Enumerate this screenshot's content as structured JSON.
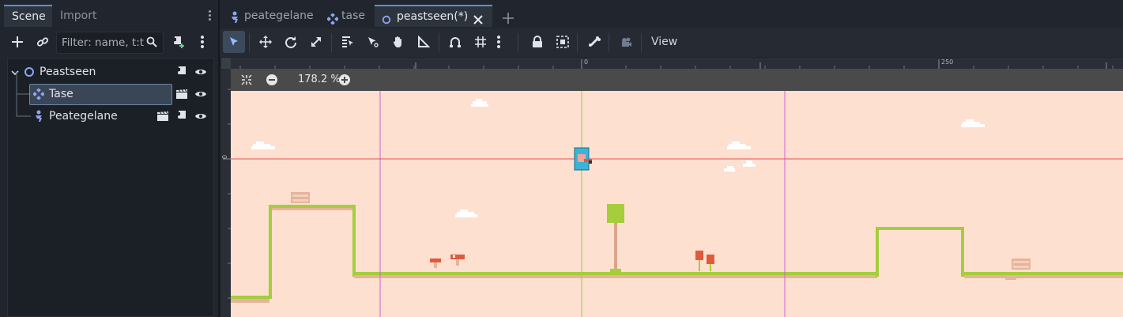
{
  "dock": {
    "tabs": [
      {
        "label": "Scene"
      },
      {
        "label": "Import"
      }
    ],
    "filter_placeholder": "Filter: name, t:t"
  },
  "tree": {
    "nodes": [
      {
        "label": "Peastseen",
        "type": "node2d"
      },
      {
        "label": "Tase",
        "type": "tilemap"
      },
      {
        "label": "Peategelane",
        "type": "character"
      }
    ]
  },
  "scene_tabs": [
    {
      "label": "peategelane"
    },
    {
      "label": "tase"
    },
    {
      "label": "peastseen(*)"
    }
  ],
  "toolbar": {
    "view_label": "View"
  },
  "viewport": {
    "zoom": "178.2 %",
    "ruler_top_labels": [
      "0",
      "250"
    ],
    "ruler_left_labels": [
      "0"
    ],
    "colors": {
      "sky": "#fde0d0",
      "grass": "#a5cd3c",
      "dirt": "#e6b49b",
      "axis_x": "#e85050",
      "axis_y": "#8fd14f",
      "guide": "#d35fd8"
    }
  }
}
